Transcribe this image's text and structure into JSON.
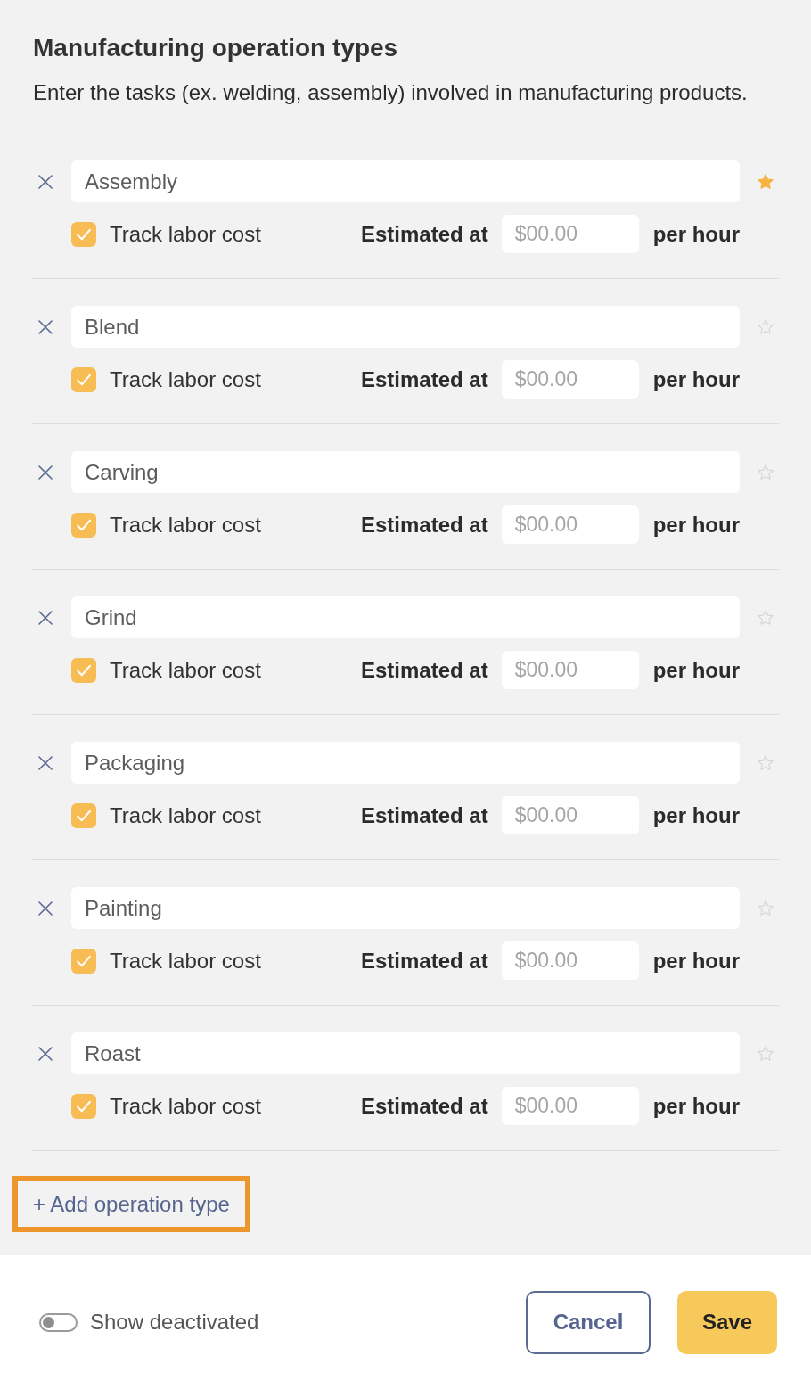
{
  "header": {
    "title": "Manufacturing operation types",
    "description": "Enter the tasks (ex. welding, assembly) involved in manufacturing products."
  },
  "rows": [
    {
      "name": "Assembly",
      "starred": true,
      "track_label": "Track labor cost",
      "track_labor": true,
      "estimate_label": "Estimated at",
      "rate_placeholder": "$00.00",
      "unit": "per hour"
    },
    {
      "name": "Blend",
      "starred": false,
      "track_label": "Track labor cost",
      "track_labor": true,
      "estimate_label": "Estimated at",
      "rate_placeholder": "$00.00",
      "unit": "per hour"
    },
    {
      "name": "Carving",
      "starred": false,
      "track_label": "Track labor cost",
      "track_labor": true,
      "estimate_label": "Estimated at",
      "rate_placeholder": "$00.00",
      "unit": "per hour"
    },
    {
      "name": "Grind",
      "starred": false,
      "track_label": "Track labor cost",
      "track_labor": true,
      "estimate_label": "Estimated at",
      "rate_placeholder": "$00.00",
      "unit": "per hour"
    },
    {
      "name": "Packaging",
      "starred": false,
      "track_label": "Track labor cost",
      "track_labor": true,
      "estimate_label": "Estimated at",
      "rate_placeholder": "$00.00",
      "unit": "per hour"
    },
    {
      "name": "Painting",
      "starred": false,
      "track_label": "Track labor cost",
      "track_labor": true,
      "estimate_label": "Estimated at",
      "rate_placeholder": "$00.00",
      "unit": "per hour"
    },
    {
      "name": "Roast",
      "starred": false,
      "track_label": "Track labor cost",
      "track_labor": true,
      "estimate_label": "Estimated at",
      "rate_placeholder": "$00.00",
      "unit": "per hour"
    }
  ],
  "add_button": {
    "label": "+ Add operation type",
    "highlighted": true
  },
  "footer": {
    "toggle": {
      "label": "Show deactivated",
      "on": false
    },
    "buttons": [
      {
        "label": "Cancel",
        "kind": "secondary"
      },
      {
        "label": "Save",
        "kind": "primary"
      }
    ]
  }
}
